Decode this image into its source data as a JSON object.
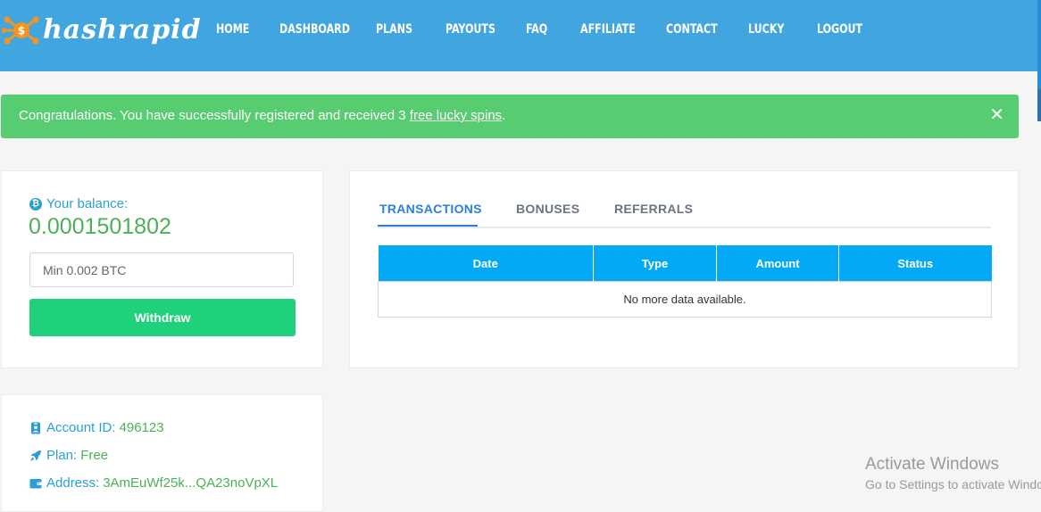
{
  "brand": {
    "name": "hashrapid"
  },
  "nav": {
    "items": [
      {
        "label": "HOME"
      },
      {
        "label": "DASHBOARD"
      },
      {
        "label": "PLANS"
      },
      {
        "label": "PAYOUTS"
      },
      {
        "label": "FAQ"
      },
      {
        "label": "AFFILIATE"
      },
      {
        "label": "CONTACT"
      },
      {
        "label": "LUCKY"
      },
      {
        "label": "LOGOUT"
      }
    ]
  },
  "alert": {
    "text_before": "Congratulations. You have successfully registered and received 3 ",
    "link_text": "free lucky spins",
    "text_after": ".",
    "close_symbol": "✕"
  },
  "balance": {
    "label": "Your balance:",
    "icon": "bitcoin-icon",
    "value": "0.0001501802",
    "input_placeholder": "Min 0.002 BTC",
    "withdraw_label": "Withdraw"
  },
  "transactions": {
    "tabs": [
      {
        "label": "TRANSACTIONS",
        "active": true
      },
      {
        "label": "BONUSES",
        "active": false
      },
      {
        "label": "REFERRALS",
        "active": false
      }
    ],
    "columns": [
      "Date",
      "Type",
      "Amount",
      "Status"
    ],
    "empty_message": "No more data available."
  },
  "account": {
    "id_label": "Account ID:",
    "id_value": "496123",
    "plan_label": "Plan:",
    "plan_value": "Free",
    "address_label": "Address:",
    "address_value": "3AmEuWf25k...QA23noVpXL"
  },
  "watermark": {
    "title": "Activate Windows",
    "subtitle": "Go to Settings to activate Windows."
  },
  "colors": {
    "header": "#41a6e0",
    "alert": "#57cc71",
    "accent_blue": "#2a9fd6",
    "accent_green": "#4cb05a",
    "withdraw_button": "#1fd17b",
    "table_header": "#03a9f4"
  }
}
